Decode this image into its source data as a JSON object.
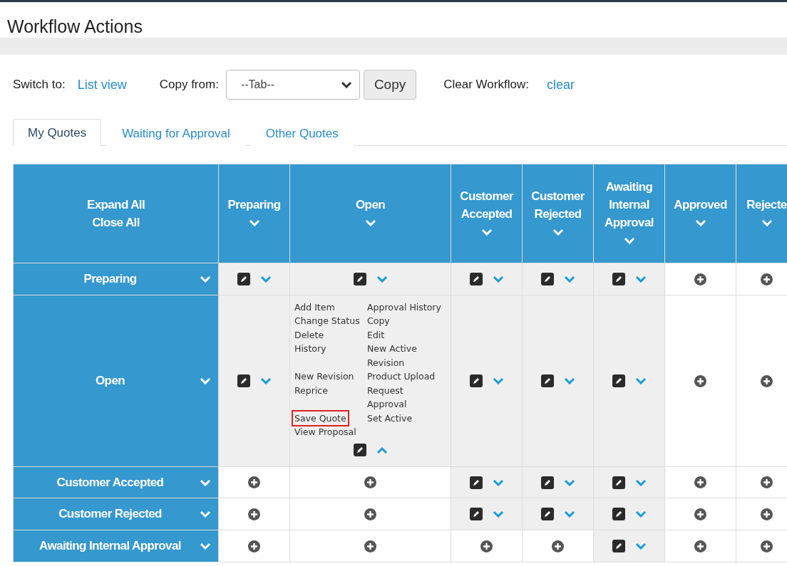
{
  "page": {
    "title": "Workflow Actions"
  },
  "toolbar": {
    "switch_label": "Switch to:",
    "switch_link": "List view",
    "copy_label": "Copy from:",
    "copy_select": {
      "value": "--Tab--"
    },
    "copy_button": "Copy",
    "clear_label": "Clear Workflow:",
    "clear_link": "clear"
  },
  "tabs": [
    {
      "label": "My Quotes",
      "selected": true
    },
    {
      "label": "Waiting for Approval",
      "selected": false
    },
    {
      "label": "Other Quotes",
      "selected": false
    }
  ],
  "table": {
    "corner": {
      "expand_all": "Expand All",
      "close_all": "Close All"
    },
    "columns": [
      {
        "label": "Preparing"
      },
      {
        "label": "Open"
      },
      {
        "label": "Customer Accepted"
      },
      {
        "label": "Customer Rejected"
      },
      {
        "label": "Awaiting Internal Approval"
      },
      {
        "label": "Approved"
      },
      {
        "label": "Rejecte"
      }
    ],
    "rows": [
      {
        "label": "Preparing",
        "cells": [
          {
            "kind": "edit"
          },
          {
            "kind": "edit"
          },
          {
            "kind": "edit"
          },
          {
            "kind": "edit"
          },
          {
            "kind": "edit"
          },
          {
            "kind": "add"
          },
          {
            "kind": "add"
          }
        ]
      },
      {
        "label": "Open",
        "cells": [
          {
            "kind": "edit"
          },
          {
            "kind": "actions",
            "expanded": true,
            "actions": [
              {
                "label": "Add Item",
                "selected": false
              },
              {
                "label": "Approval History",
                "selected": false
              },
              {
                "label": "Change Status",
                "selected": false
              },
              {
                "label": "Copy",
                "selected": false
              },
              {
                "label": "Delete",
                "selected": false
              },
              {
                "label": "Edit",
                "selected": false
              },
              {
                "label": "History",
                "selected": false
              },
              {
                "label": "New Active Revision",
                "selected": false
              },
              {
                "label": "New Revision",
                "selected": false
              },
              {
                "label": "Product Upload",
                "selected": false
              },
              {
                "label": "Reprice",
                "selected": false
              },
              {
                "label": "Request Approval",
                "selected": false
              },
              {
                "label": "Save Quote",
                "selected": true
              },
              {
                "label": "Set Active",
                "selected": false
              },
              {
                "label": "View Proposal",
                "selected": false
              }
            ]
          },
          {
            "kind": "edit"
          },
          {
            "kind": "edit"
          },
          {
            "kind": "edit"
          },
          {
            "kind": "add"
          },
          {
            "kind": "add"
          }
        ]
      },
      {
        "label": "Customer Accepted",
        "cells": [
          {
            "kind": "add"
          },
          {
            "kind": "add"
          },
          {
            "kind": "edit"
          },
          {
            "kind": "edit"
          },
          {
            "kind": "edit"
          },
          {
            "kind": "add"
          },
          {
            "kind": "add"
          }
        ]
      },
      {
        "label": "Customer Rejected",
        "cells": [
          {
            "kind": "add"
          },
          {
            "kind": "add"
          },
          {
            "kind": "edit"
          },
          {
            "kind": "edit"
          },
          {
            "kind": "edit"
          },
          {
            "kind": "add"
          },
          {
            "kind": "add"
          }
        ]
      },
      {
        "label": "Awaiting Internal Approval",
        "cells": [
          {
            "kind": "add"
          },
          {
            "kind": "add"
          },
          {
            "kind": "add"
          },
          {
            "kind": "add"
          },
          {
            "kind": "edit"
          },
          {
            "kind": "add"
          },
          {
            "kind": "add"
          }
        ]
      }
    ]
  }
}
